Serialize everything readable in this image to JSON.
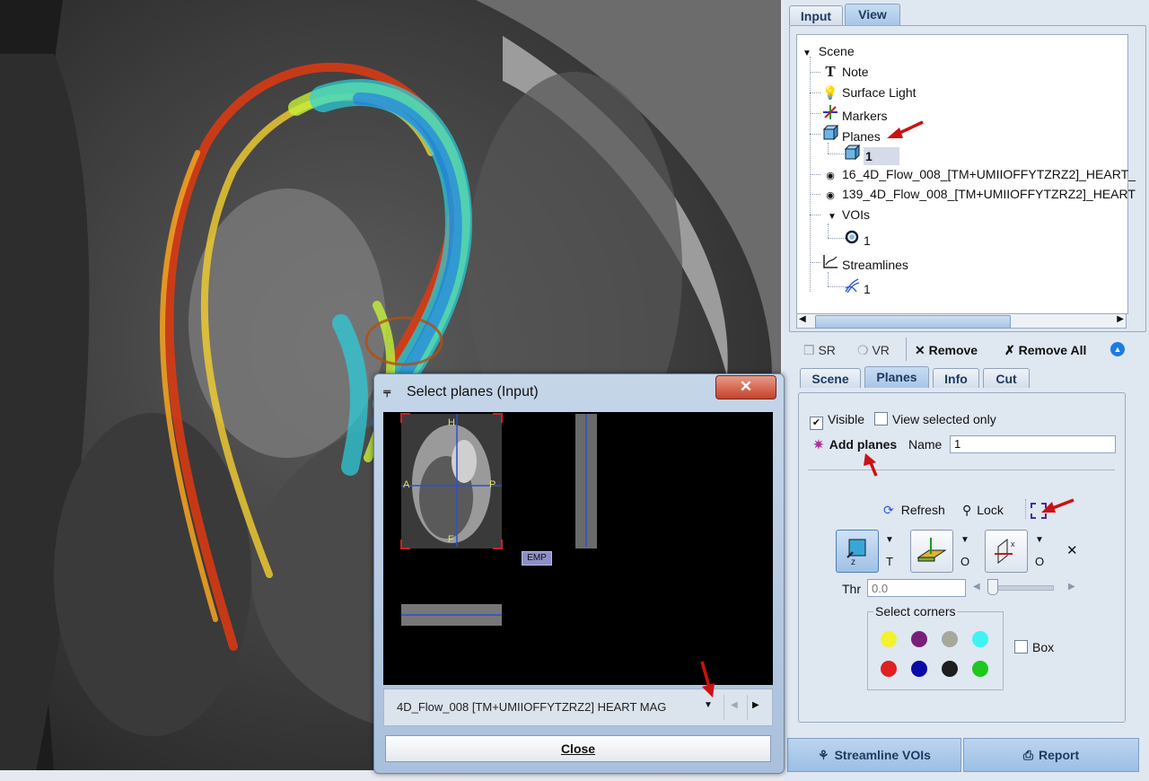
{
  "main_tabs": [
    {
      "label": "Input"
    },
    {
      "label": "View"
    }
  ],
  "tree": {
    "scene": "Scene",
    "note": "Note",
    "surface_light": "Surface Light",
    "markers": "Markers",
    "planes": "Planes",
    "planes_child": "1",
    "flow1": "16_4D_Flow_008_[TM+UMIIOFFYTZRZ2]_HEART_",
    "flow2": "139_4D_Flow_008_[TM+UMIIOFFYTZRZ2]_HEART",
    "vois": "VOIs",
    "vois_child": "1",
    "streamlines": "Streamlines",
    "streamlines_child": "1"
  },
  "toolbar": {
    "sr": "SR",
    "vr": "VR",
    "remove": "Remove",
    "remove_all": "Remove All"
  },
  "sub_tabs": [
    {
      "label": "Scene"
    },
    {
      "label": "Planes"
    },
    {
      "label": "Info"
    },
    {
      "label": "Cut"
    }
  ],
  "planes_panel": {
    "visible_label": "Visible",
    "visible_checked": true,
    "view_selected_label": "View selected only",
    "view_selected_checked": false,
    "add_planes_label": "Add planes",
    "name_label": "Name",
    "name_value": "1",
    "refresh_label": "Refresh",
    "lock_label": "Lock",
    "plane_buttons": [
      {
        "icon": "transversal-plane-icon",
        "mode": "T",
        "selected": true
      },
      {
        "icon": "coronal-plane-icon",
        "mode": "O",
        "selected": false
      },
      {
        "icon": "sagittal-plane-icon",
        "mode": "O",
        "selected": false
      }
    ],
    "thr_label": "Thr",
    "thr_placeholder": "0.0",
    "corners_label": "Select corners",
    "corner_colors": [
      "#f2f22e",
      "#7a1f78",
      "#a8a89a",
      "#3ff3f3",
      "#e02020",
      "#0a0aa8",
      "#1e1e1e",
      "#1ec81e"
    ],
    "box_label": "Box",
    "box_checked": false
  },
  "bottom_buttons": {
    "streamline_vois": "Streamline VOIs",
    "report": "Report"
  },
  "dialog": {
    "title": "Select planes (Input)",
    "close_x": "✕",
    "series": "4D_Flow_008 [TM+UMIIOFFYTZRZ2] HEART MAG",
    "empty_tag": "EMP",
    "orient": {
      "h": "H",
      "f": "F",
      "a": "A",
      "p": "P"
    },
    "close_label": "Close"
  },
  "colors": {
    "arrow": "#cc1111",
    "accent": "#1f3a60"
  }
}
